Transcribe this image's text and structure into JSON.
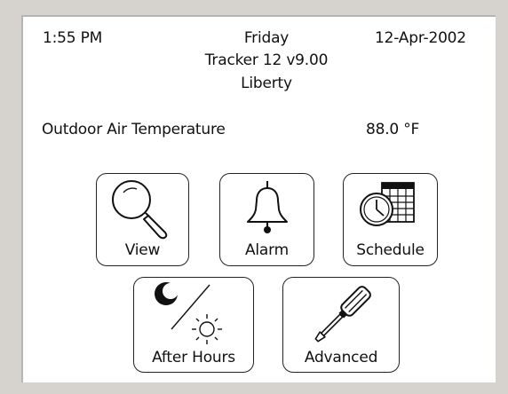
{
  "header": {
    "time": "1:55 PM",
    "day": "Friday",
    "date": "12-Apr-2002",
    "device": "Tracker 12 v9.00",
    "location": "Liberty"
  },
  "reading": {
    "label": "Outdoor Air Temperature",
    "value": "88.0 °F"
  },
  "buttons": {
    "view": "View",
    "alarm": "Alarm",
    "schedule": "Schedule",
    "after_hours": "After Hours",
    "advanced": "Advanced"
  },
  "icons": {
    "view": "magnifier-icon",
    "alarm": "bell-icon",
    "schedule": "clock-calendar-icon",
    "after_hours": "moon-sun-icon",
    "advanced": "screwdriver-icon"
  },
  "colors": {
    "frame": "#d6d3ce",
    "screen": "#ffffff",
    "ink": "#111111"
  }
}
